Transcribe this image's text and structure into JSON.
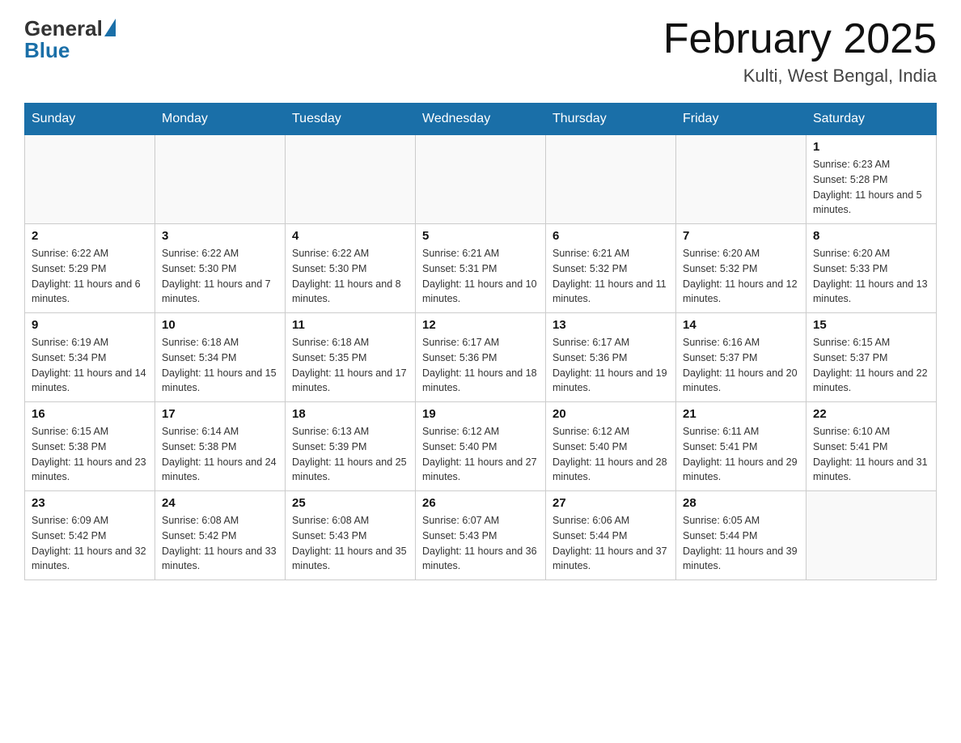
{
  "logo": {
    "general": "General",
    "blue": "Blue"
  },
  "title": "February 2025",
  "location": "Kulti, West Bengal, India",
  "days_of_week": [
    "Sunday",
    "Monday",
    "Tuesday",
    "Wednesday",
    "Thursday",
    "Friday",
    "Saturday"
  ],
  "weeks": [
    [
      {
        "day": "",
        "info": ""
      },
      {
        "day": "",
        "info": ""
      },
      {
        "day": "",
        "info": ""
      },
      {
        "day": "",
        "info": ""
      },
      {
        "day": "",
        "info": ""
      },
      {
        "day": "",
        "info": ""
      },
      {
        "day": "1",
        "info": "Sunrise: 6:23 AM\nSunset: 5:28 PM\nDaylight: 11 hours and 5 minutes."
      }
    ],
    [
      {
        "day": "2",
        "info": "Sunrise: 6:22 AM\nSunset: 5:29 PM\nDaylight: 11 hours and 6 minutes."
      },
      {
        "day": "3",
        "info": "Sunrise: 6:22 AM\nSunset: 5:30 PM\nDaylight: 11 hours and 7 minutes."
      },
      {
        "day": "4",
        "info": "Sunrise: 6:22 AM\nSunset: 5:30 PM\nDaylight: 11 hours and 8 minutes."
      },
      {
        "day": "5",
        "info": "Sunrise: 6:21 AM\nSunset: 5:31 PM\nDaylight: 11 hours and 10 minutes."
      },
      {
        "day": "6",
        "info": "Sunrise: 6:21 AM\nSunset: 5:32 PM\nDaylight: 11 hours and 11 minutes."
      },
      {
        "day": "7",
        "info": "Sunrise: 6:20 AM\nSunset: 5:32 PM\nDaylight: 11 hours and 12 minutes."
      },
      {
        "day": "8",
        "info": "Sunrise: 6:20 AM\nSunset: 5:33 PM\nDaylight: 11 hours and 13 minutes."
      }
    ],
    [
      {
        "day": "9",
        "info": "Sunrise: 6:19 AM\nSunset: 5:34 PM\nDaylight: 11 hours and 14 minutes."
      },
      {
        "day": "10",
        "info": "Sunrise: 6:18 AM\nSunset: 5:34 PM\nDaylight: 11 hours and 15 minutes."
      },
      {
        "day": "11",
        "info": "Sunrise: 6:18 AM\nSunset: 5:35 PM\nDaylight: 11 hours and 17 minutes."
      },
      {
        "day": "12",
        "info": "Sunrise: 6:17 AM\nSunset: 5:36 PM\nDaylight: 11 hours and 18 minutes."
      },
      {
        "day": "13",
        "info": "Sunrise: 6:17 AM\nSunset: 5:36 PM\nDaylight: 11 hours and 19 minutes."
      },
      {
        "day": "14",
        "info": "Sunrise: 6:16 AM\nSunset: 5:37 PM\nDaylight: 11 hours and 20 minutes."
      },
      {
        "day": "15",
        "info": "Sunrise: 6:15 AM\nSunset: 5:37 PM\nDaylight: 11 hours and 22 minutes."
      }
    ],
    [
      {
        "day": "16",
        "info": "Sunrise: 6:15 AM\nSunset: 5:38 PM\nDaylight: 11 hours and 23 minutes."
      },
      {
        "day": "17",
        "info": "Sunrise: 6:14 AM\nSunset: 5:38 PM\nDaylight: 11 hours and 24 minutes."
      },
      {
        "day": "18",
        "info": "Sunrise: 6:13 AM\nSunset: 5:39 PM\nDaylight: 11 hours and 25 minutes."
      },
      {
        "day": "19",
        "info": "Sunrise: 6:12 AM\nSunset: 5:40 PM\nDaylight: 11 hours and 27 minutes."
      },
      {
        "day": "20",
        "info": "Sunrise: 6:12 AM\nSunset: 5:40 PM\nDaylight: 11 hours and 28 minutes."
      },
      {
        "day": "21",
        "info": "Sunrise: 6:11 AM\nSunset: 5:41 PM\nDaylight: 11 hours and 29 minutes."
      },
      {
        "day": "22",
        "info": "Sunrise: 6:10 AM\nSunset: 5:41 PM\nDaylight: 11 hours and 31 minutes."
      }
    ],
    [
      {
        "day": "23",
        "info": "Sunrise: 6:09 AM\nSunset: 5:42 PM\nDaylight: 11 hours and 32 minutes."
      },
      {
        "day": "24",
        "info": "Sunrise: 6:08 AM\nSunset: 5:42 PM\nDaylight: 11 hours and 33 minutes."
      },
      {
        "day": "25",
        "info": "Sunrise: 6:08 AM\nSunset: 5:43 PM\nDaylight: 11 hours and 35 minutes."
      },
      {
        "day": "26",
        "info": "Sunrise: 6:07 AM\nSunset: 5:43 PM\nDaylight: 11 hours and 36 minutes."
      },
      {
        "day": "27",
        "info": "Sunrise: 6:06 AM\nSunset: 5:44 PM\nDaylight: 11 hours and 37 minutes."
      },
      {
        "day": "28",
        "info": "Sunrise: 6:05 AM\nSunset: 5:44 PM\nDaylight: 11 hours and 39 minutes."
      },
      {
        "day": "",
        "info": ""
      }
    ]
  ]
}
